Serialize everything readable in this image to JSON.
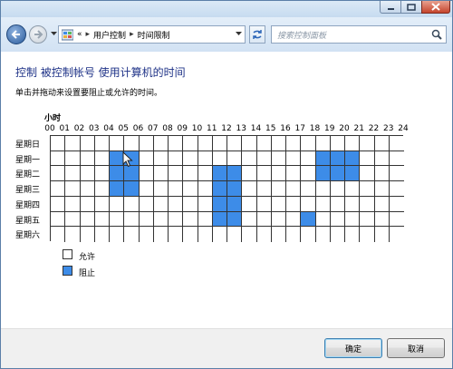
{
  "window": {
    "buttons": [
      "minimize-icon",
      "maximize-icon",
      "close-icon"
    ]
  },
  "nav": {
    "breadcrumb_prefix": "«",
    "breadcrumbs": [
      "用户控制",
      "时间限制"
    ],
    "separator": "▸",
    "search_placeholder": "搜索控制面板"
  },
  "content": {
    "title": "控制 被控制帐号 使用计算机的时间",
    "instruction": "单击并拖动来设置要阻止或允许的时间。",
    "hour_label": "小时",
    "hours": [
      "00",
      "01",
      "02",
      "03",
      "04",
      "05",
      "06",
      "07",
      "08",
      "09",
      "10",
      "11",
      "12",
      "13",
      "14",
      "15",
      "16",
      "17",
      "18",
      "19",
      "20",
      "21",
      "22",
      "23",
      "24"
    ],
    "days": [
      "星期日",
      "星期一",
      "星期二",
      "星期三",
      "星期四",
      "星期五",
      "星期六"
    ],
    "blocked": [
      [],
      [
        4,
        5,
        18,
        19,
        20
      ],
      [
        4,
        5,
        11,
        12,
        18,
        19,
        20
      ],
      [
        4,
        5,
        11,
        12
      ],
      [
        11,
        12
      ],
      [
        11,
        12,
        17
      ],
      []
    ],
    "legend": {
      "allow": "允许",
      "block": "阻止"
    },
    "colors": {
      "blocked": "#3d8ce8",
      "title": "#1e3287"
    }
  },
  "footer": {
    "ok_label": "确定",
    "cancel_label": "取消"
  }
}
